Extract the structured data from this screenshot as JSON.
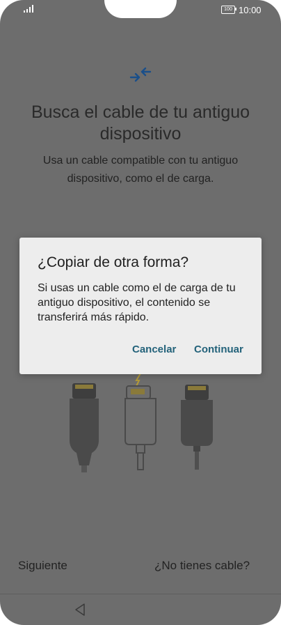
{
  "status_bar": {
    "battery_level": "100",
    "time": "10:00",
    "icons": [
      "signal-icon",
      "battery-icon"
    ]
  },
  "main": {
    "header_icon": "transfer-arrows-icon",
    "title": "Busca el cable de tu antiguo dispositivo",
    "subtitle": "Usa un cable compatible con tu antiguo dispositivo, como el de carga.",
    "illustration": "cables-illustration"
  },
  "dialog": {
    "title": "¿Copiar de otra forma?",
    "body": "Si usas un cable como el de carga de tu antiguo dispositivo, el contenido se transferirá más rápido.",
    "cancel_label": "Cancelar",
    "continue_label": "Continuar"
  },
  "footer": {
    "next_label": "Siguiente",
    "no_cable_label": "¿No tienes cable?"
  },
  "nav_bar": {
    "back_icon": "back-triangle-icon"
  },
  "colors": {
    "scrim": "#6d6d6d",
    "dialog_bg": "#ededed",
    "accent": "#23627a",
    "icon_blue": "#1a4f8a"
  }
}
